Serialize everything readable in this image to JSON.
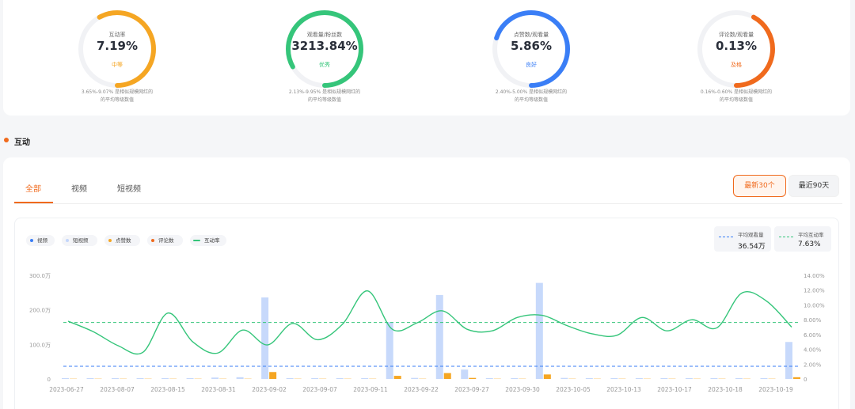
{
  "gauges": [
    {
      "label": "互动率",
      "value": "7.19%",
      "level": "中等",
      "color": "#f5a623",
      "level_color": "#f5a623",
      "fraction": 0.58,
      "note_line1": "3.65%-9.07% 是相似规模网红的",
      "note_line2": "的平均等级数值"
    },
    {
      "label": "观看量/粉丝数",
      "value": "3213.84%",
      "level": "优秀",
      "color": "#35c57a",
      "level_color": "#35c57a",
      "fraction": 0.83,
      "note_line1": "2.13%-9.95% 是相似规模网红的",
      "note_line2": "的平均等级数值"
    },
    {
      "label": "点赞数/观看量",
      "value": "5.86%",
      "level": "良好",
      "color": "#3a7ef6",
      "level_color": "#3a7ef6",
      "fraction": 0.7,
      "note_line1": "2.40%-5.00% 是相似规模网红的",
      "note_line2": "的平均等级数值"
    },
    {
      "label": "评论数/观看量",
      "value": "0.13%",
      "level": "及格",
      "color": "#f06a1d",
      "level_color": "#f06a1d",
      "fraction": 0.42,
      "note_line1": "0.16%-0.60% 是相似规模网红的",
      "note_line2": "的平均等级数值"
    }
  ],
  "section": {
    "title": "互动"
  },
  "tabs": [
    {
      "label": "全部",
      "active": true
    },
    {
      "label": "视频",
      "active": false
    },
    {
      "label": "短视频",
      "active": false
    }
  ],
  "range": {
    "active": "最新30个",
    "inactive": "最近90天"
  },
  "legend": [
    {
      "label": "视频",
      "color": "#3a7ef6",
      "kind": "dot"
    },
    {
      "label": "短视频",
      "color": "#c3d6fb",
      "kind": "dot"
    },
    {
      "label": "点赞数",
      "color": "#f5a623",
      "kind": "dot"
    },
    {
      "label": "评论数",
      "color": "#f06a1d",
      "kind": "dot"
    },
    {
      "label": "互动率",
      "color": "#35c57a",
      "kind": "line"
    }
  ],
  "averages": [
    {
      "label": "平均观看量",
      "value": "36.54万",
      "color": "#3a7ef6"
    },
    {
      "label": "平均互动率",
      "value": "7.63%",
      "color": "#35c57a"
    }
  ],
  "chart_data": {
    "type": "bar",
    "left_axis": {
      "ticks": [
        "0",
        "100.0万",
        "200.0万",
        "300.0万"
      ],
      "range": [
        0,
        300
      ]
    },
    "right_axis": {
      "ticks": [
        "0",
        "2.00%",
        "4.00%",
        "6.00%",
        "8.00%",
        "10.00%",
        "12.00%",
        "14.00%"
      ],
      "range": [
        0,
        14
      ]
    },
    "x_labels": [
      "2023-06-27",
      "2023-08-07",
      "2023-08-15",
      "2023-08-31",
      "2023-09-02",
      "2023-09-07",
      "2023-09-11",
      "2023-09-22",
      "2023-09-27",
      "2023-09-30",
      "2023-10-05",
      "2023-10-13",
      "2023-10-17",
      "2023-10-18",
      "2023-10-19"
    ],
    "series": [
      {
        "name": "短视频",
        "values": [
          0,
          0,
          0,
          0,
          0,
          0,
          4,
          5,
          236,
          0,
          0,
          0,
          0,
          165,
          3,
          243,
          27,
          0,
          0,
          278,
          3,
          0,
          0,
          0,
          0,
          0,
          0,
          0,
          0,
          107
        ]
      },
      {
        "name": "点赞数",
        "values": [
          0,
          0,
          0,
          0,
          0,
          0,
          0,
          0,
          20,
          0,
          0,
          0,
          0,
          9,
          0,
          17,
          3,
          0,
          0,
          13,
          0,
          0,
          0,
          0,
          0,
          0,
          0,
          0,
          0,
          5
        ]
      },
      {
        "name": "互动率",
        "values": [
          7.8,
          6.4,
          4.5,
          3.6,
          8.9,
          5.0,
          3.5,
          6.6,
          4.6,
          7.5,
          5.3,
          7.4,
          11.9,
          6.7,
          7.6,
          9.2,
          6.7,
          6.5,
          8.3,
          8.6,
          7.2,
          6.1,
          5.9,
          8.3,
          6.5,
          8.0,
          6.9,
          11.6,
          10.5,
          7.0
        ]
      }
    ],
    "avg_views_wan": 36.54,
    "avg_rate": 7.63
  }
}
